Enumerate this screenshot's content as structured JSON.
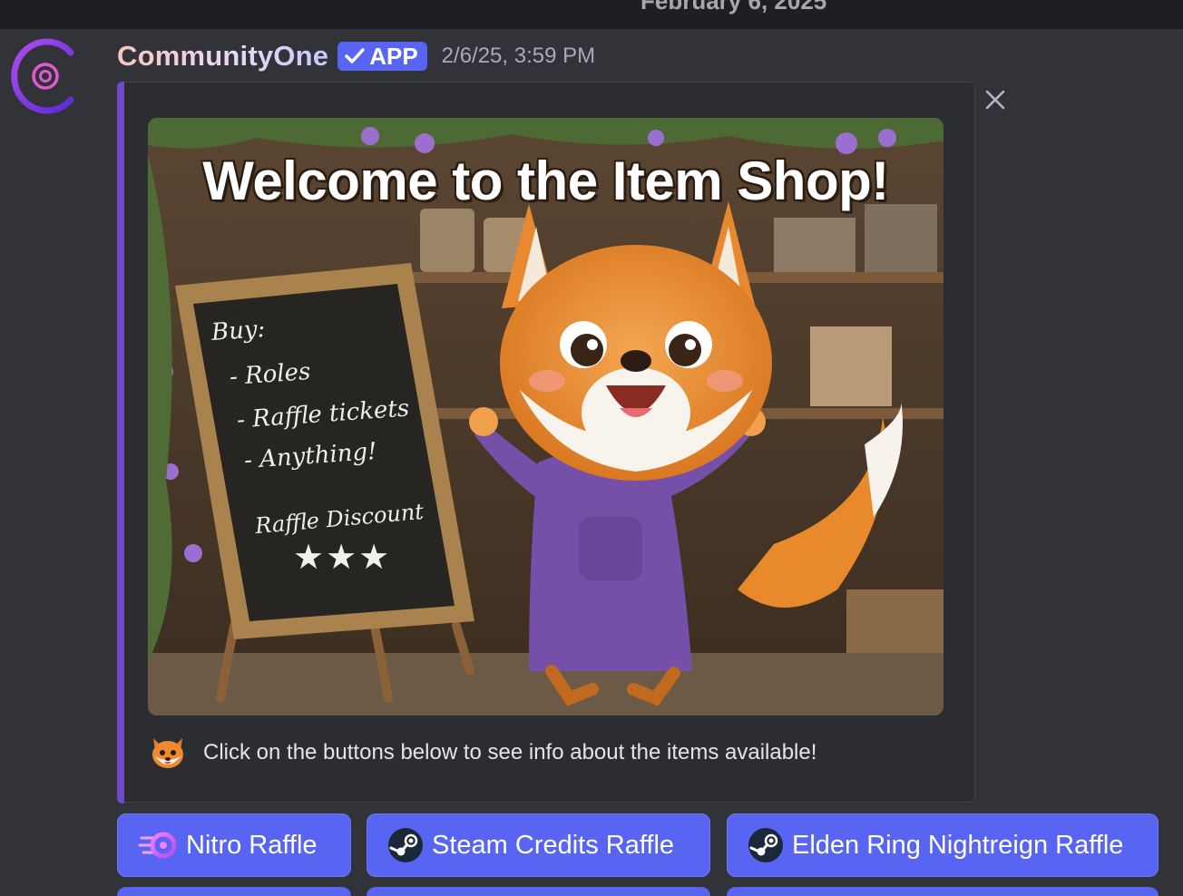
{
  "divider": {
    "date": "February 6, 2025"
  },
  "message": {
    "author": "CommunityOne",
    "badge": "APP",
    "timestamp": "2/6/25, 3:59 PM",
    "avatar_icon": "communityone-logo-icon",
    "embed": {
      "accent_color": "#6f4bc9",
      "image": {
        "title": "Welcome to the Item Shop!",
        "board_lines": [
          "Buy:",
          "- Roles",
          "- Raffle tickets",
          "- Anything!",
          "Raffle Discount"
        ],
        "board_stars": "★★★"
      },
      "footer_icon": "fox-emoji-icon",
      "footer_text": "Click on the buttons below to see info about the items available!"
    },
    "buttons": [
      {
        "label": "Nitro Raffle",
        "icon": "nitro-icon"
      },
      {
        "label": "Steam Credits Raffle",
        "icon": "steam-icon"
      },
      {
        "label": "Elden Ring Nightreign Raffle",
        "icon": "steam-icon"
      }
    ]
  },
  "colors": {
    "button": "#5865f2",
    "background": "#323339",
    "embed": "#2b2d31"
  }
}
